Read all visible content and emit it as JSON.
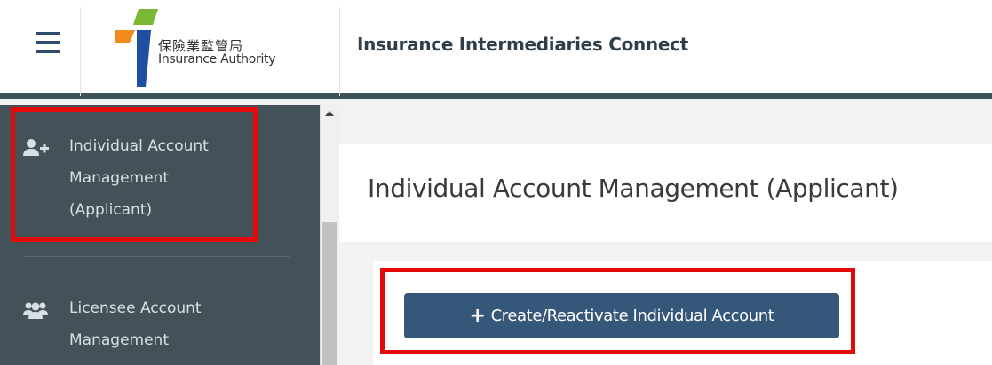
{
  "header": {
    "logo_zh": "保險業監管局",
    "logo_en": "Insurance Authority",
    "app_title": "Insurance Intermediaries Connect"
  },
  "sidebar": {
    "items": [
      {
        "label_line1": "Individual Account",
        "label_line2": "Management",
        "label_line3": "(Applicant)",
        "icon": "user-plus-icon"
      },
      {
        "label_line1": "Licensee Account",
        "label_line2": "Management",
        "icon": "users-group-icon"
      }
    ]
  },
  "main": {
    "page_title": "Individual Account Management (Applicant)",
    "create_button": {
      "icon": "+",
      "label": "Create/Reactivate Individual Account"
    }
  },
  "colors": {
    "sidebar_bg": "#435259",
    "button_bg": "#34577a",
    "highlight": "#e20a0a",
    "logo_orange": "#f28a1e",
    "logo_green": "#7ab733",
    "logo_blue": "#1e4fa2"
  }
}
